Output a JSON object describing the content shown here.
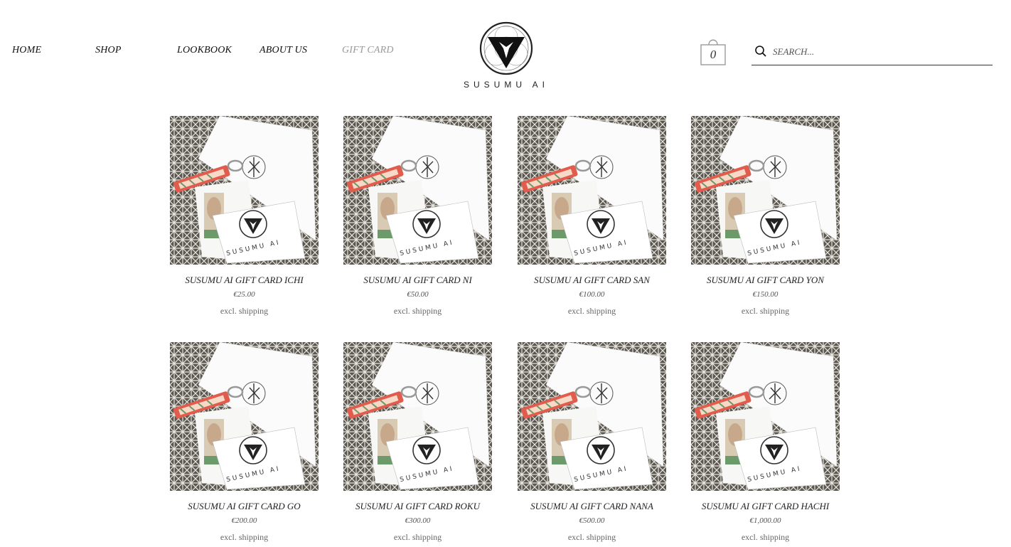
{
  "nav": [
    {
      "label": "HOME",
      "active": false
    },
    {
      "label": "SHOP",
      "active": false
    },
    {
      "label": "LOOKBOOK",
      "active": false
    },
    {
      "label": "ABOUT US",
      "active": false
    },
    {
      "label": "GIFT CARD",
      "active": true
    }
  ],
  "brand": {
    "name": "SUSUMU AI"
  },
  "cart": {
    "count": "0"
  },
  "search": {
    "placeholder": "SEARCH..."
  },
  "colors": {
    "text": "#222222",
    "nav_active": "#9a9a9a",
    "pattern_dark": "#5a5650",
    "card": "#ffffff"
  },
  "products": [
    {
      "name": "SUSUMU AI GIFT CARD ICHI",
      "price": "€25.00",
      "shipping": "excl. shipping"
    },
    {
      "name": "SUSUMU AI GIFT CARD NI",
      "price": "€50.00",
      "shipping": "excl. shipping"
    },
    {
      "name": "SUSUMU AI GIFT CARD SAN",
      "price": "€100.00",
      "shipping": "excl. shipping"
    },
    {
      "name": "SUSUMU AI GIFT CARD YON",
      "price": "€150.00",
      "shipping": "excl. shipping"
    },
    {
      "name": "SUSUMU AI GIFT CARD GO",
      "price": "€200.00",
      "shipping": "excl. shipping"
    },
    {
      "name": "SUSUMU AI GIFT CARD ROKU",
      "price": "€300.00",
      "shipping": "excl. shipping"
    },
    {
      "name": "SUSUMU AI GIFT CARD NANA",
      "price": "€500.00",
      "shipping": "excl. shipping"
    },
    {
      "name": "SUSUMU AI GIFT CARD HACHI",
      "price": "€1,000.00",
      "shipping": "excl. shipping"
    }
  ]
}
